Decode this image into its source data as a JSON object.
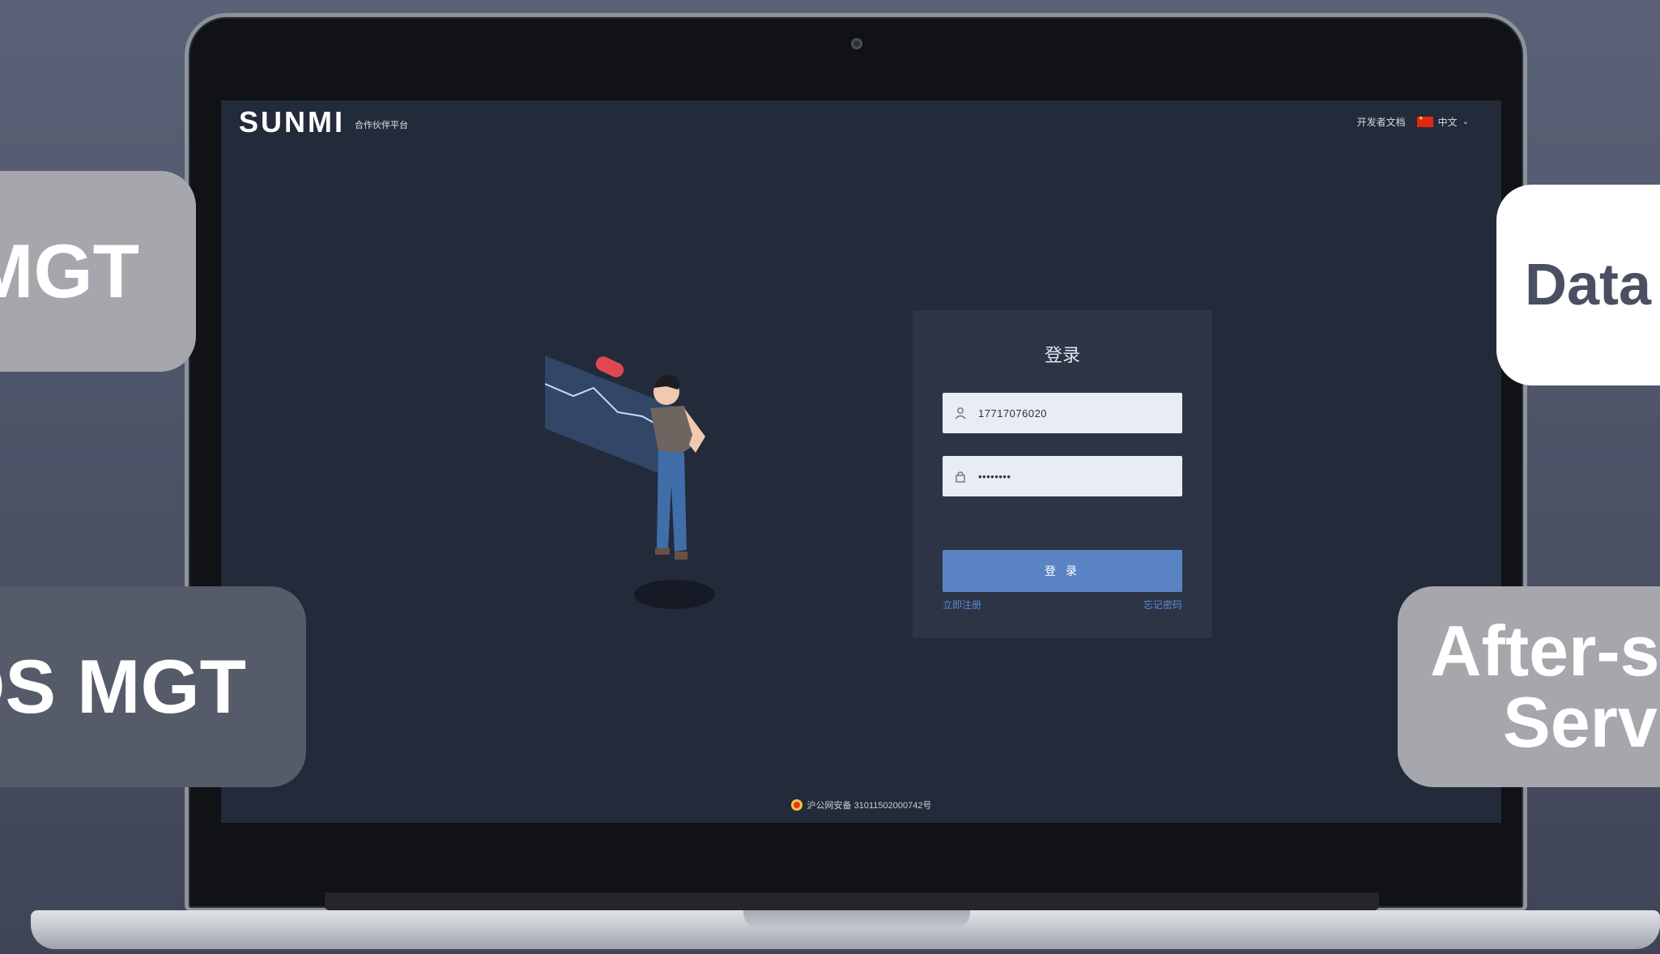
{
  "app": {
    "logo_text": "SUNMI",
    "logo_subtitle": "合作伙伴平台",
    "nav_docs": "开发者文档",
    "language": "中文",
    "language_flag_icon": "china-flag-icon"
  },
  "login": {
    "title": "登录",
    "username_value": "17717076020",
    "password_value": "••••••••",
    "submit_label": "登 录",
    "register_link": "立即注册",
    "forgot_link": "忘记密码"
  },
  "footer": {
    "icp_text": "沪公网安备 31011502000742号"
  },
  "overlay_labels": {
    "top_left": "MGT",
    "bottom_left": "OS MGT",
    "top_right": "Data",
    "bottom_right_line1": "After-s",
    "bottom_right_line2": "Serv"
  },
  "colors": {
    "screen_bg": "#232a39",
    "card_bg": "#2c3446",
    "primary_button": "#5a83c4",
    "link": "#5b8ad6"
  }
}
